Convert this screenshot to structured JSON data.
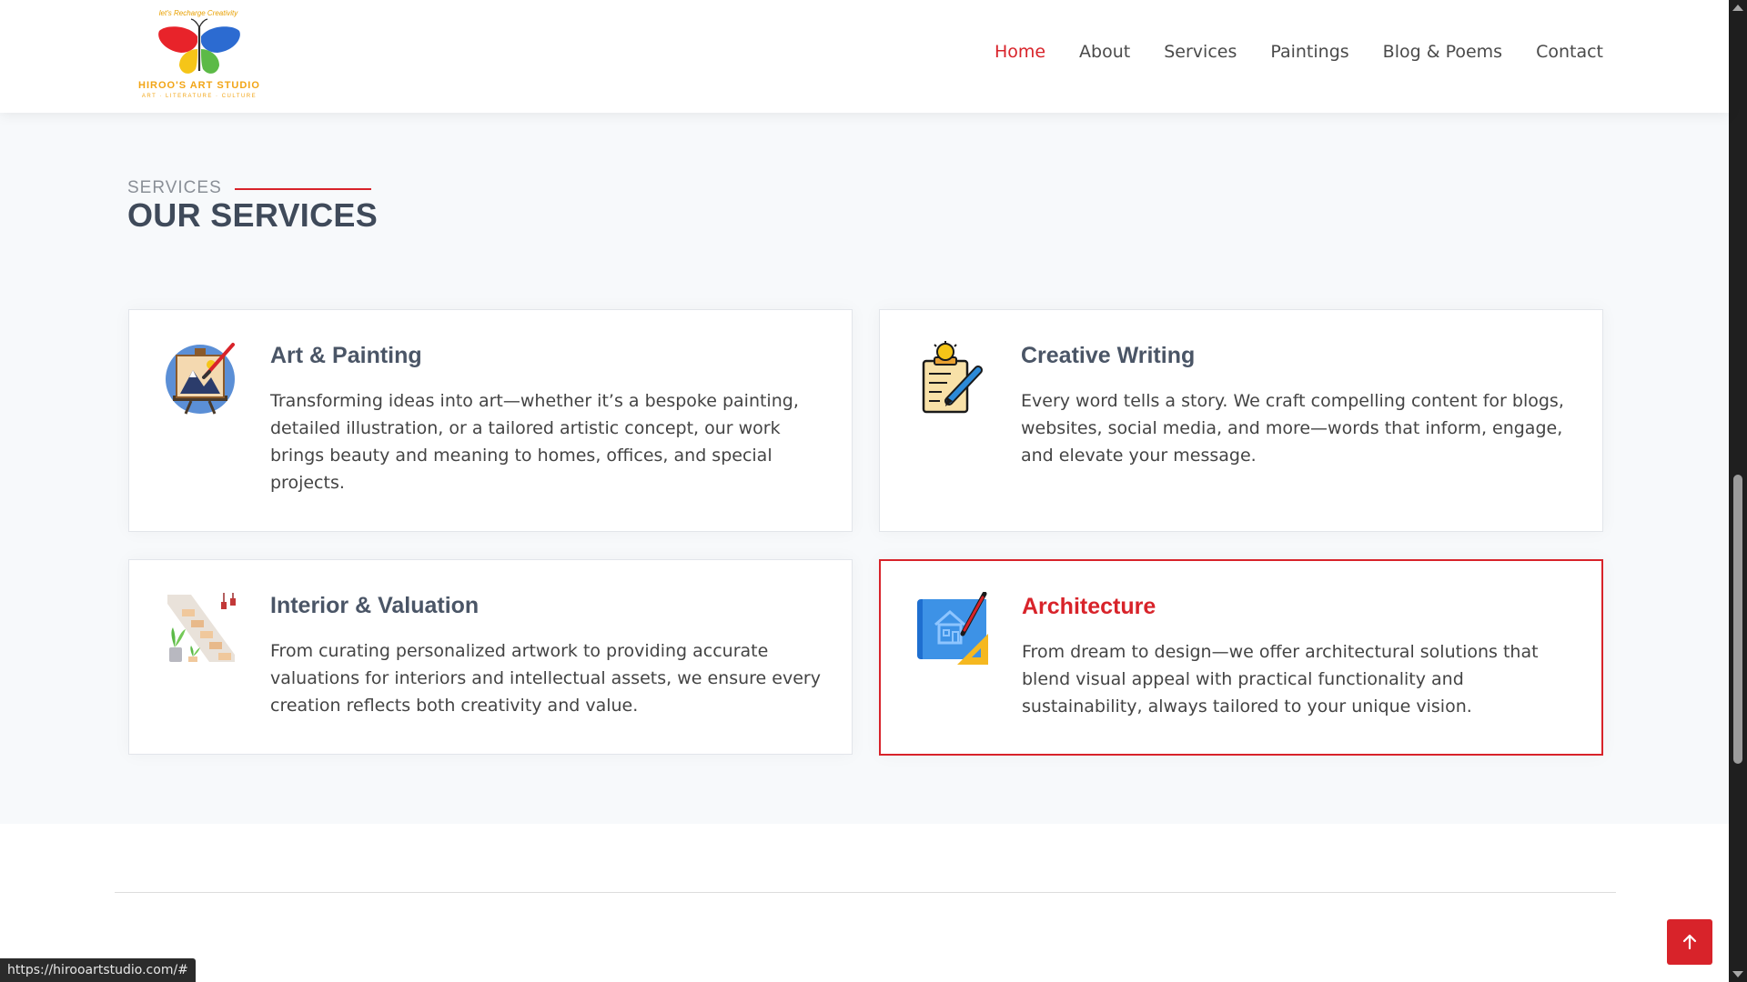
{
  "header": {
    "logo": {
      "tagline": "let's Recharge Creativity",
      "name": "HIROO'S ART STUDIO",
      "subtitle": "ART · LITERATURE · CULTURE"
    },
    "nav": [
      {
        "label": "Home",
        "active": true
      },
      {
        "label": "About",
        "active": false
      },
      {
        "label": "Services",
        "active": false
      },
      {
        "label": "Paintings",
        "active": false
      },
      {
        "label": "Blog & Poems",
        "active": false
      },
      {
        "label": "Contact",
        "active": false
      }
    ]
  },
  "services_section": {
    "label": "SERVICES",
    "title": "OUR SERVICES",
    "cards": [
      {
        "title": "Art & Painting",
        "icon": "painting-easel-icon",
        "description": "Transforming ideas into art—whether it’s a bespoke painting, detailed illustration, or a tailored artistic concept, our work brings beauty and meaning to homes, offices, and special projects."
      },
      {
        "title": "Creative Writing",
        "icon": "writing-lightbulb-icon",
        "description": "Every word tells a story. We craft compelling content for blogs, websites, social media, and more—words that inform, engage, and elevate your message."
      },
      {
        "title": "Interior & Valuation",
        "icon": "interior-stairs-icon",
        "description": "From curating personalized artwork to providing accurate valuations for interiors and intellectual assets, we ensure every creation reflects both creativity and value."
      },
      {
        "title": "Architecture",
        "icon": "blueprint-icon",
        "description": "From dream to design—we offer architectural solutions that blend visual appeal with practical functionality and sustainability, always tailored to your unique vision.",
        "highlighted": true
      }
    ]
  },
  "status_bar": {
    "url": "https://hirooartstudio.com/#"
  },
  "back_to_top": {
    "icon": "arrow-up-icon"
  },
  "colors": {
    "accent": "#d8232a",
    "heading": "#3f4a5a",
    "section_bg": "#f7f9fb",
    "logo_gold": "#f2a516"
  }
}
